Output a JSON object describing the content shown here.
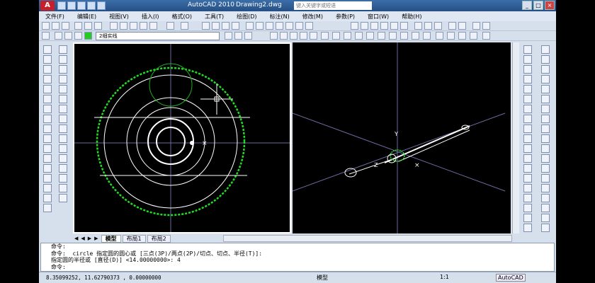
{
  "window": {
    "app_title": "AutoCAD 2010",
    "doc_title": "Drawing2.dwg",
    "search_placeholder": "键入关键字或短语"
  },
  "menu": [
    {
      "label": "文件(F)"
    },
    {
      "label": "编辑(E)"
    },
    {
      "label": "视图(V)"
    },
    {
      "label": "插入(I)"
    },
    {
      "label": "格式(O)"
    },
    {
      "label": "工具(T)"
    },
    {
      "label": "绘图(D)"
    },
    {
      "label": "标注(N)"
    },
    {
      "label": "修改(M)"
    },
    {
      "label": "参数(P)"
    },
    {
      "label": "窗口(W)"
    },
    {
      "label": "帮助(H)"
    }
  ],
  "layer": {
    "selected": "2细实线"
  },
  "tabs": {
    "model": "模型",
    "layout1": "布局1",
    "layout2": "布局2"
  },
  "command": {
    "line1": "命令:",
    "line2": "命令:  circle 指定圆的圆心或 [三点(3P)/两点(2P)/切点、切点、半径(T)]:",
    "line3": "指定圆的半径或 [直径(D)] <14.00000000>: 4",
    "line4": "命令:"
  },
  "status": {
    "coords": "8.35099252,  11.62790373 , 0.00000000",
    "model_label": "模型",
    "scale": "1:1",
    "workspace": "AutoCAD"
  },
  "colors": {
    "green_circle": "#22dd22",
    "white": "#ffffff",
    "grid": "#6a6aa0"
  }
}
